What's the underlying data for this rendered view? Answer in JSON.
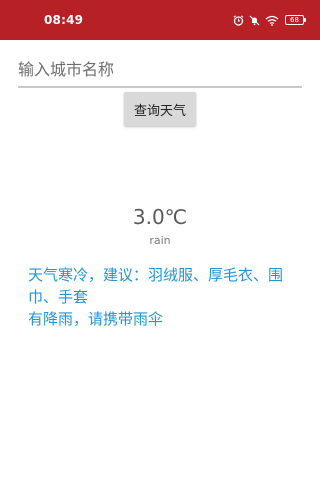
{
  "status_bar": {
    "time": "08:49",
    "background": "#b72126",
    "icons": [
      "alarm-icon",
      "mute-icon",
      "wifi-icon",
      "battery-icon"
    ],
    "battery_level": "68"
  },
  "search": {
    "placeholder": "输入城市名称",
    "value": ""
  },
  "query_button": {
    "label": "查询天气"
  },
  "weather": {
    "temperature": "3.0℃",
    "condition": "rain"
  },
  "advice": {
    "color": "#2196d3",
    "lines": [
      "天气寒冷，建议：羽绒服、厚毛衣、围巾、手套",
      "有降雨，请携带雨伞"
    ]
  }
}
